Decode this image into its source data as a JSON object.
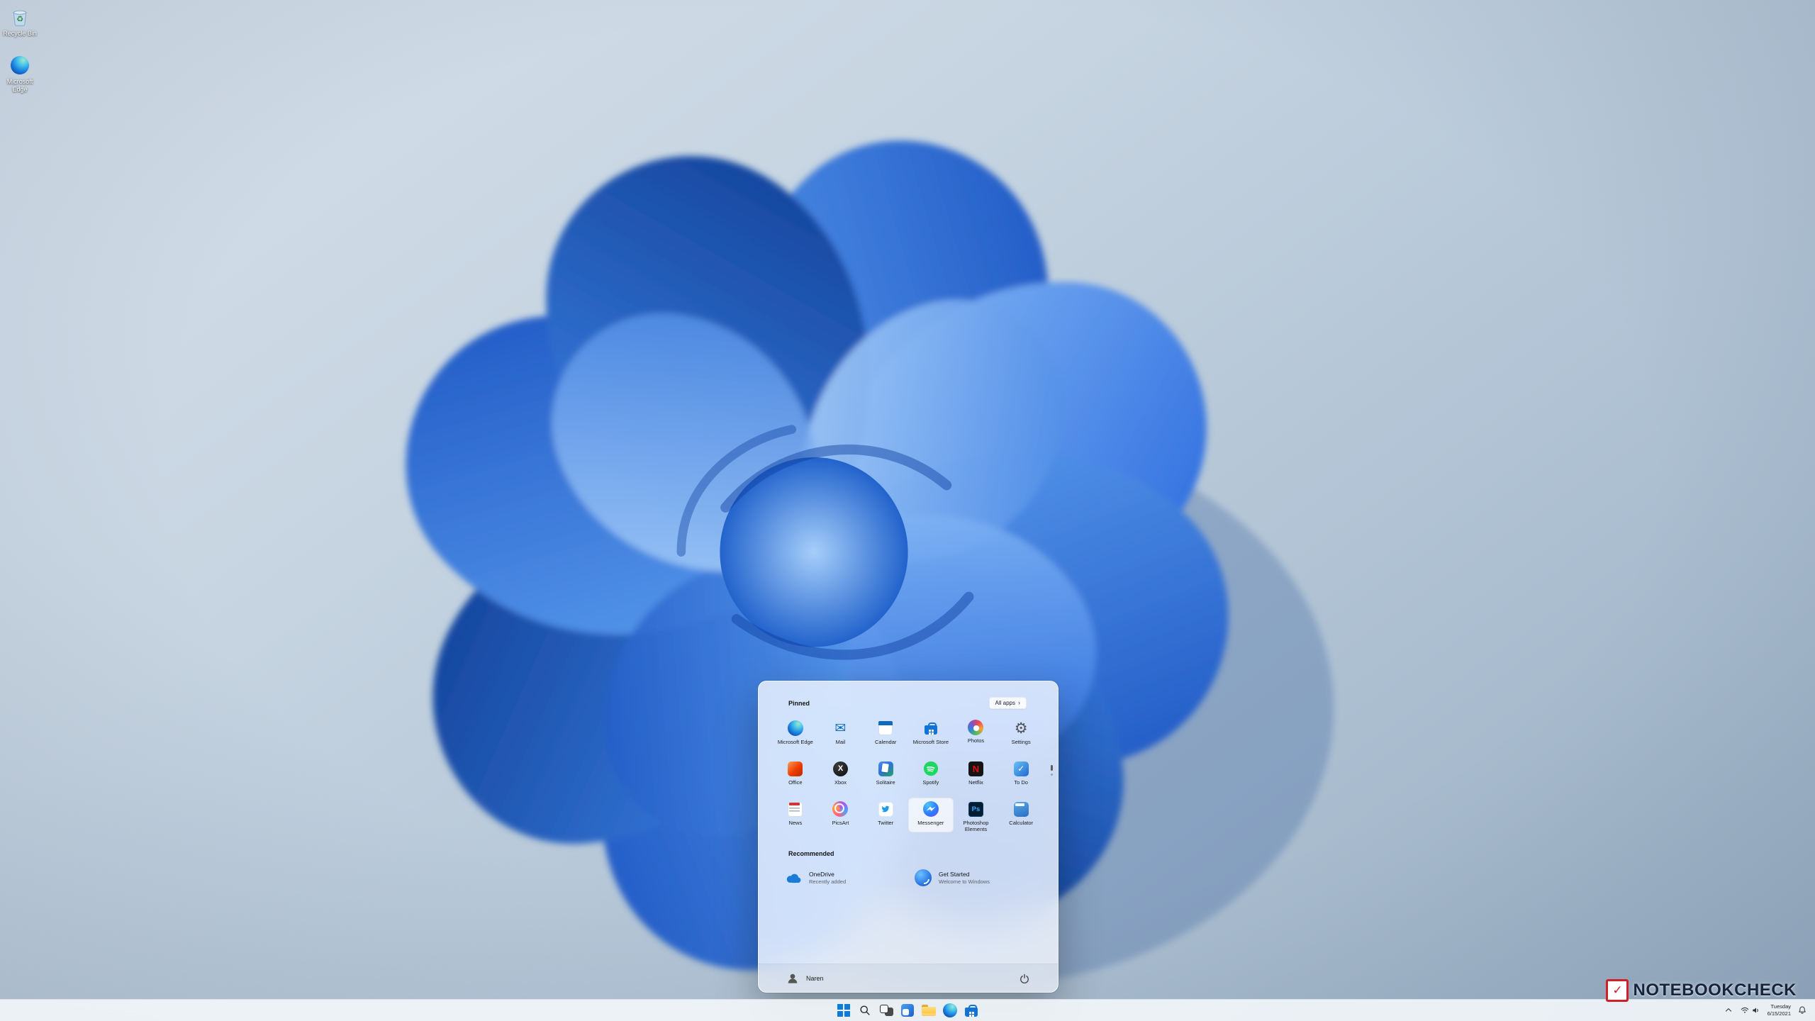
{
  "colors": {
    "accent": "#0078d4",
    "watermark_red": "#cf2027"
  },
  "desktop": {
    "icons": [
      {
        "label": "Recycle Bin",
        "icon": "recycle-bin-icon"
      },
      {
        "label": "Microsoft Edge",
        "icon": "edge-icon"
      }
    ]
  },
  "start_menu": {
    "pinned_header": "Pinned",
    "all_apps_label": "All apps",
    "pinned_apps": [
      {
        "name": "Microsoft Edge",
        "icon": "edge-icon"
      },
      {
        "name": "Mail",
        "icon": "mail-icon"
      },
      {
        "name": "Calendar",
        "icon": "calendar-icon"
      },
      {
        "name": "Microsoft Store",
        "icon": "store-icon"
      },
      {
        "name": "Photos",
        "icon": "photos-icon"
      },
      {
        "name": "Settings",
        "icon": "settings-icon"
      },
      {
        "name": "Office",
        "icon": "office-icon"
      },
      {
        "name": "Xbox",
        "icon": "xbox-icon"
      },
      {
        "name": "Solitaire",
        "icon": "solitaire-icon"
      },
      {
        "name": "Spotify",
        "icon": "spotify-icon"
      },
      {
        "name": "Netflix",
        "icon": "netflix-icon"
      },
      {
        "name": "To Do",
        "icon": "todo-icon"
      },
      {
        "name": "News",
        "icon": "news-icon"
      },
      {
        "name": "PicsArt",
        "icon": "picsart-icon"
      },
      {
        "name": "Twitter",
        "icon": "twitter-icon"
      },
      {
        "name": "Messenger",
        "icon": "messenger-icon",
        "highlighted": true
      },
      {
        "name": "Photoshop Elements",
        "icon": "photoshop-elements-icon"
      },
      {
        "name": "Calculator",
        "icon": "calculator-icon"
      }
    ],
    "recommended_header": "Recommended",
    "recommended": [
      {
        "title": "OneDrive",
        "subtitle": "Recently added",
        "icon": "onedrive-icon"
      },
      {
        "title": "Get Started",
        "subtitle": "Welcome to Windows",
        "icon": "get-started-icon"
      }
    ],
    "user_name": "Naren"
  },
  "taskbar": {
    "buttons": [
      "start",
      "search",
      "task-view",
      "widgets",
      "file-explorer",
      "edge",
      "store"
    ],
    "tray": {
      "weekday": "Tuesday",
      "date": "6/15/2021"
    }
  },
  "watermark": {
    "text": "NOTEBOOKCHECK",
    "check": "✓"
  }
}
